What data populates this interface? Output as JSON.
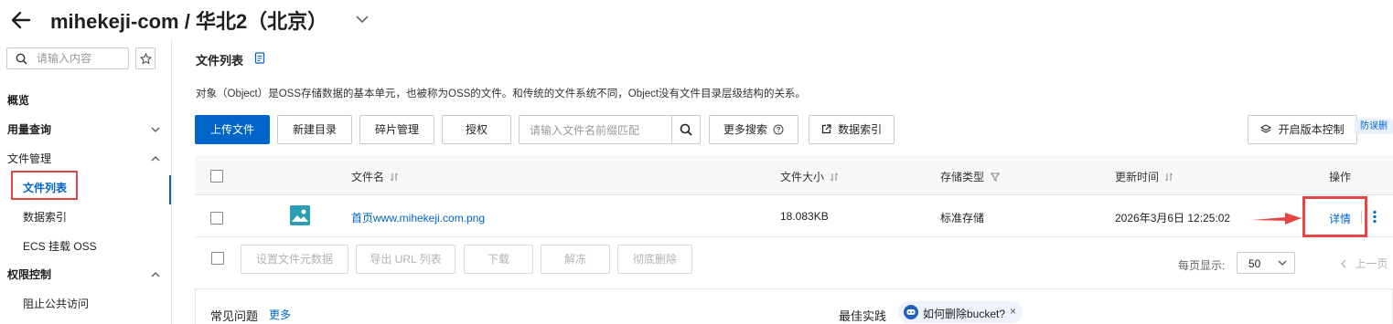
{
  "header": {
    "title": "mihekeji-com / 华北2（北京）"
  },
  "sidebar": {
    "search_placeholder": "请输入内容",
    "items": [
      {
        "label": "概览"
      },
      {
        "label": "用量查询"
      },
      {
        "label": "文件管理"
      },
      {
        "label": "文件列表"
      },
      {
        "label": "数据索引"
      },
      {
        "label": "ECS 挂载 OSS"
      },
      {
        "label": "权限控制"
      },
      {
        "label": "阻止公共访问"
      }
    ]
  },
  "main": {
    "section_title": "文件列表",
    "description": "对象（Object）是OSS存储数据的基本单元，也被称为OSS的文件。和传统的文件系统不同，Object没有文件目录层级结构的关系。",
    "toolbar": {
      "upload": "上传文件",
      "new_dir": "新建目录",
      "fragments": "碎片管理",
      "authorize": "授权",
      "search_placeholder": "请输入文件名前缀匹配",
      "more_search": "更多搜索",
      "data_index": "数据索引",
      "versioning": "开启版本控制",
      "anti_mistake": "防误删"
    },
    "table": {
      "columns": [
        "文件名",
        "文件大小",
        "存储类型",
        "更新时间",
        "操作"
      ],
      "rows": [
        {
          "name": "首页www.mihekeji.com.png",
          "size": "18.083KB",
          "storage": "标准存储",
          "updated": "2026年3月6日 12:25:02",
          "action": "详情"
        }
      ]
    },
    "bulk_actions": [
      "设置文件元数据",
      "导出 URL 列表",
      "下载",
      "解冻",
      "彻底删除"
    ],
    "pagination": {
      "per_page_label": "每页显示:",
      "per_page_value": "50",
      "prev": "上一页"
    },
    "faq": {
      "title": "常见问题",
      "more": "更多",
      "best_practice": "最佳实践",
      "tag": "如何删除bucket?",
      "tag_close": "×"
    }
  },
  "colors": {
    "primary": "#0064c8",
    "highlight_red": "#e54545",
    "text": "#1f1f1f",
    "muted": "#999999"
  },
  "icons": [
    "back-arrow-icon",
    "chevron-down-icon",
    "search-icon",
    "star-icon",
    "document-icon",
    "question-circle-icon",
    "external-link-icon",
    "layers-icon",
    "sort-icon",
    "filter-icon",
    "image-file-icon",
    "more-vertical-icon",
    "robot-icon"
  ]
}
